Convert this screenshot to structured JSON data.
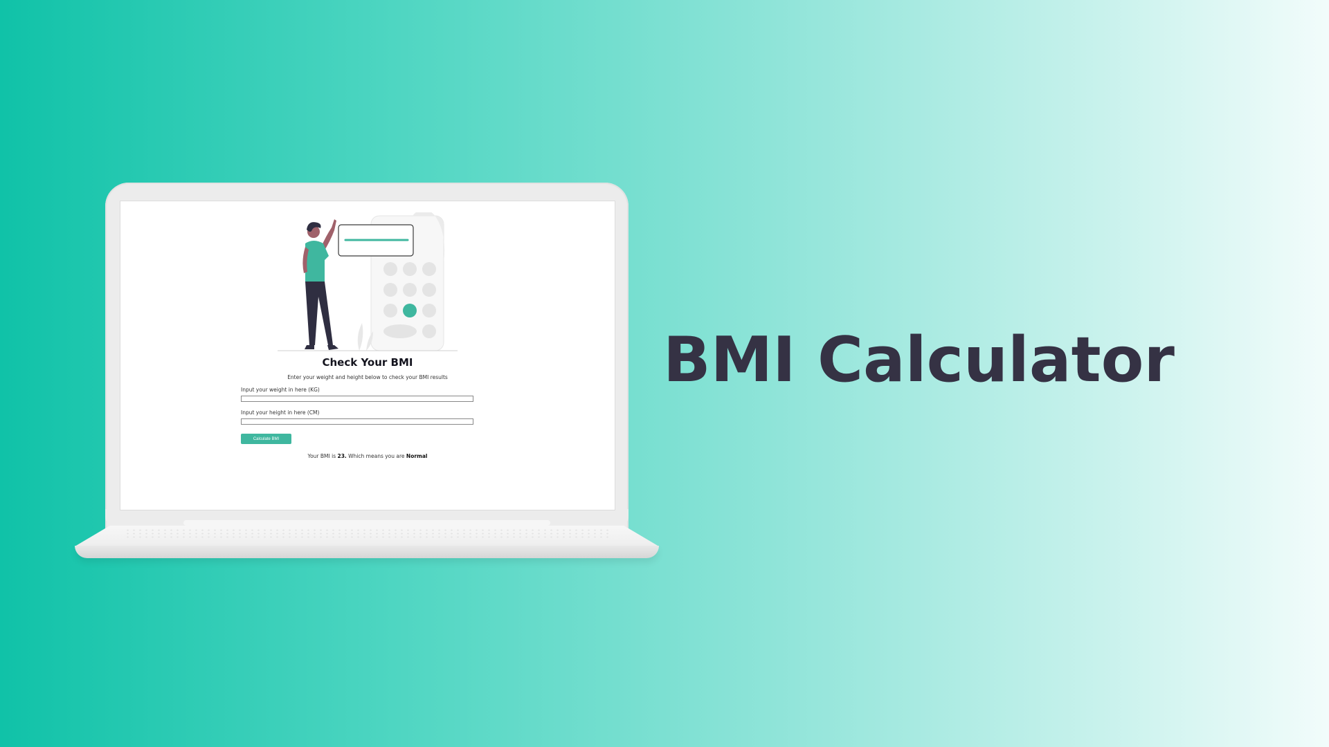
{
  "hero": {
    "title": "BMI Calculator"
  },
  "app": {
    "title": "Check Your BMI",
    "subtitle": "Enter your weight and height below to check your BMI results",
    "weight_label": "Input your weight in here (KG)",
    "weight_value": "",
    "height_label": "Input your height in here (CM)",
    "height_value": "",
    "button_label": "Calculate BMI",
    "result": {
      "prefix": "Your BMI is ",
      "value": "23.",
      "middle": " Which means you are ",
      "category": "Normal"
    }
  },
  "colors": {
    "accent": "#3fb79f",
    "title_dark": "#353244",
    "background_start": "#10c2a8",
    "background_end": "#f2fcfb"
  },
  "icons": {
    "illustration": "person-calculator-illustration"
  }
}
